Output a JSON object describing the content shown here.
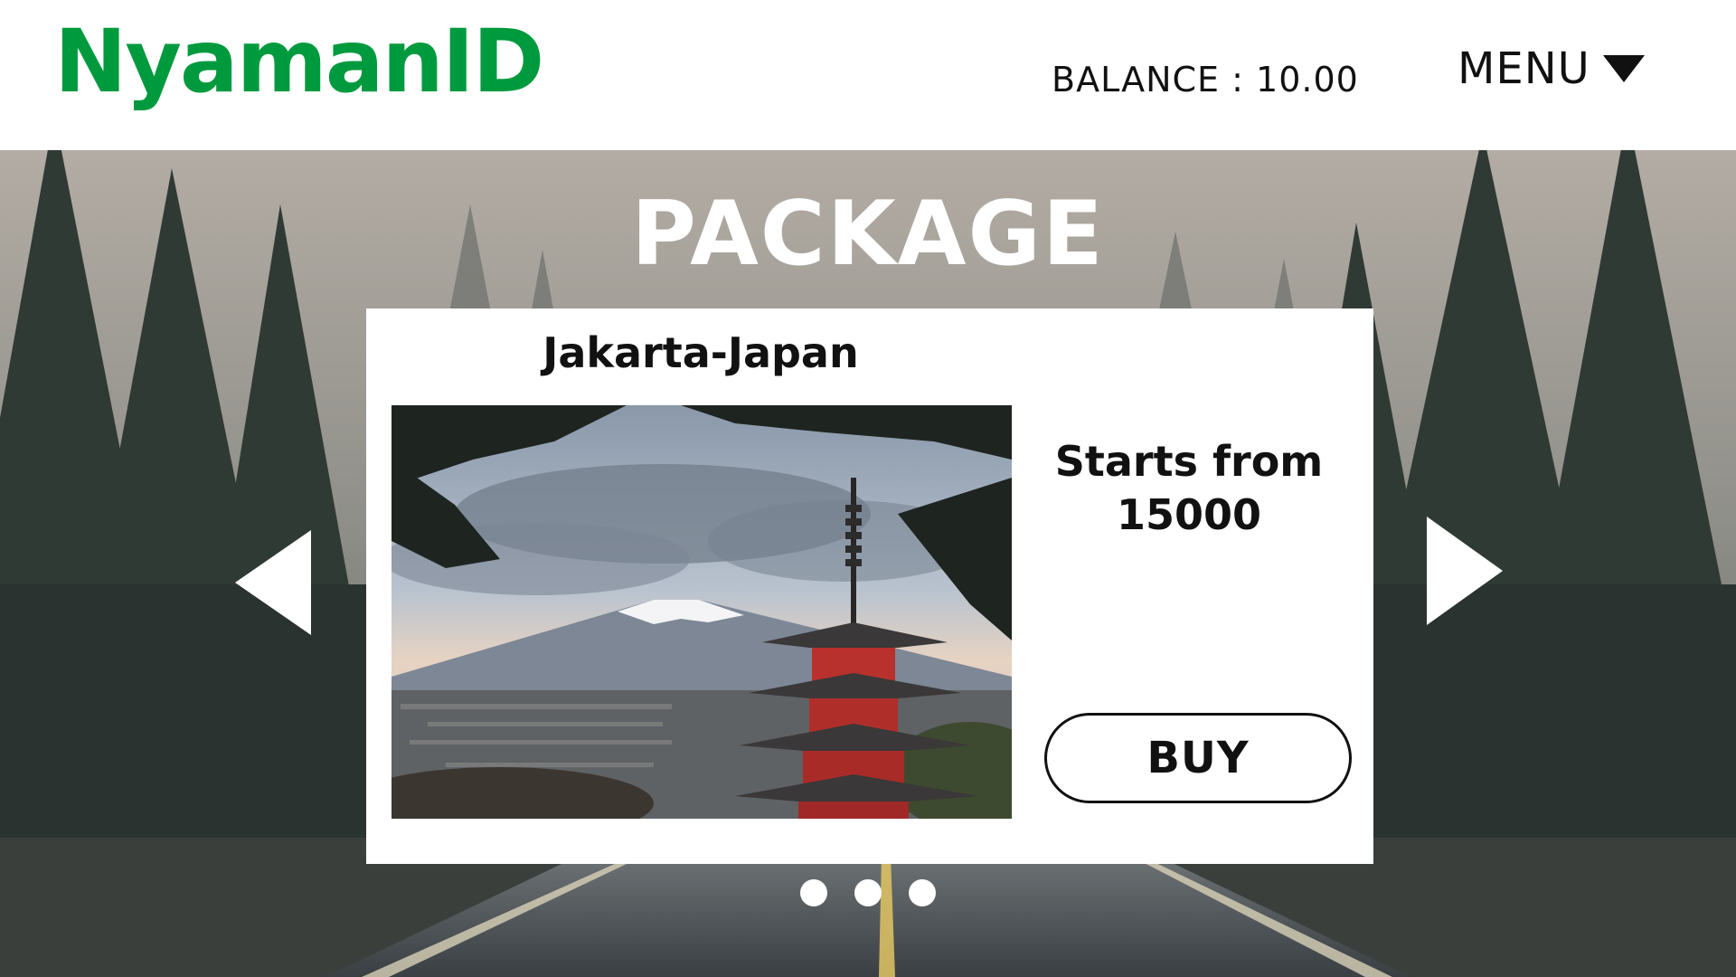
{
  "header": {
    "logo": "NyamanID",
    "balance": "BALANCE : 10.00",
    "menu_label": "MENU"
  },
  "hero": {
    "title": "PACKAGE"
  },
  "package_card": {
    "title": "Jakarta-Japan",
    "price_line1": "Starts from",
    "price_line2": "15000",
    "buy_label": "BUY"
  },
  "carousel": {
    "dot_count": 3
  },
  "icons": {
    "menu": "caret-down-icon",
    "prev": "arrow-left-icon",
    "next": "arrow-right-icon"
  },
  "colors": {
    "brand": "#009a3e",
    "text": "#111111",
    "white": "#ffffff"
  }
}
